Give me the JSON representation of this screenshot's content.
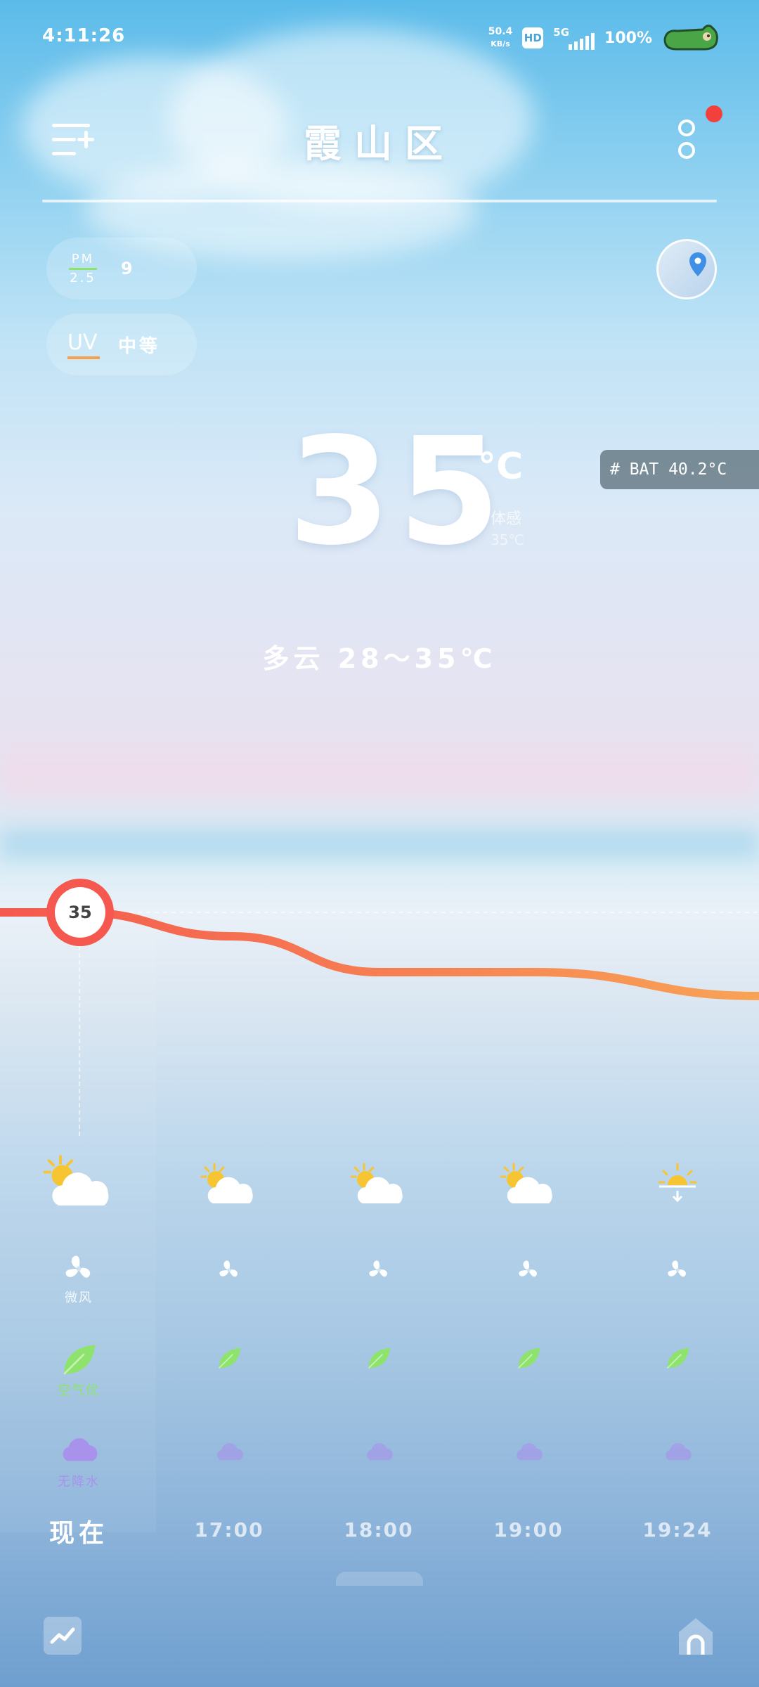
{
  "status_bar": {
    "time": "4:11:26",
    "net_speed_value": "50.4",
    "net_speed_unit": "KB/s",
    "hd_label": "HD",
    "network_label": "5G",
    "battery_percent": "100%"
  },
  "header": {
    "title": "霞山区",
    "has_notification": true
  },
  "air": {
    "pm_label_top": "PM",
    "pm_label_bottom": "2.5",
    "pm_value": "9",
    "uv_label": "UV",
    "uv_value": "中等"
  },
  "current": {
    "temperature": "35",
    "unit": "°C",
    "feels_label": "体感",
    "feels_value": "35℃",
    "condition_text": "多云  28～35℃"
  },
  "debug_badge": "# BAT 40.2°C",
  "chart_data": {
    "type": "line",
    "x": [
      "现在",
      "17:00",
      "18:00",
      "19:00",
      "19:24",
      ""
    ],
    "y": [
      35,
      35,
      34,
      32.5,
      32.5,
      31.5
    ],
    "current_label": "35"
  },
  "hourly": {
    "wind_label": "微风",
    "air_quality_label": "空气优",
    "rain_label": "无降水",
    "times": [
      "现在",
      "17:00",
      "18:00",
      "19:00",
      "19:24"
    ],
    "weather_icons": [
      "partly-cloudy-icon",
      "partly-cloudy-icon",
      "partly-cloudy-icon",
      "partly-cloudy-icon",
      "sunset-icon"
    ]
  },
  "colors": {
    "temp_line_start": "#f4584f",
    "temp_line_end": "#f8a356",
    "air_good": "#8ee36c",
    "rain": "#a992ec",
    "uv_accent": "#f6a04d"
  }
}
